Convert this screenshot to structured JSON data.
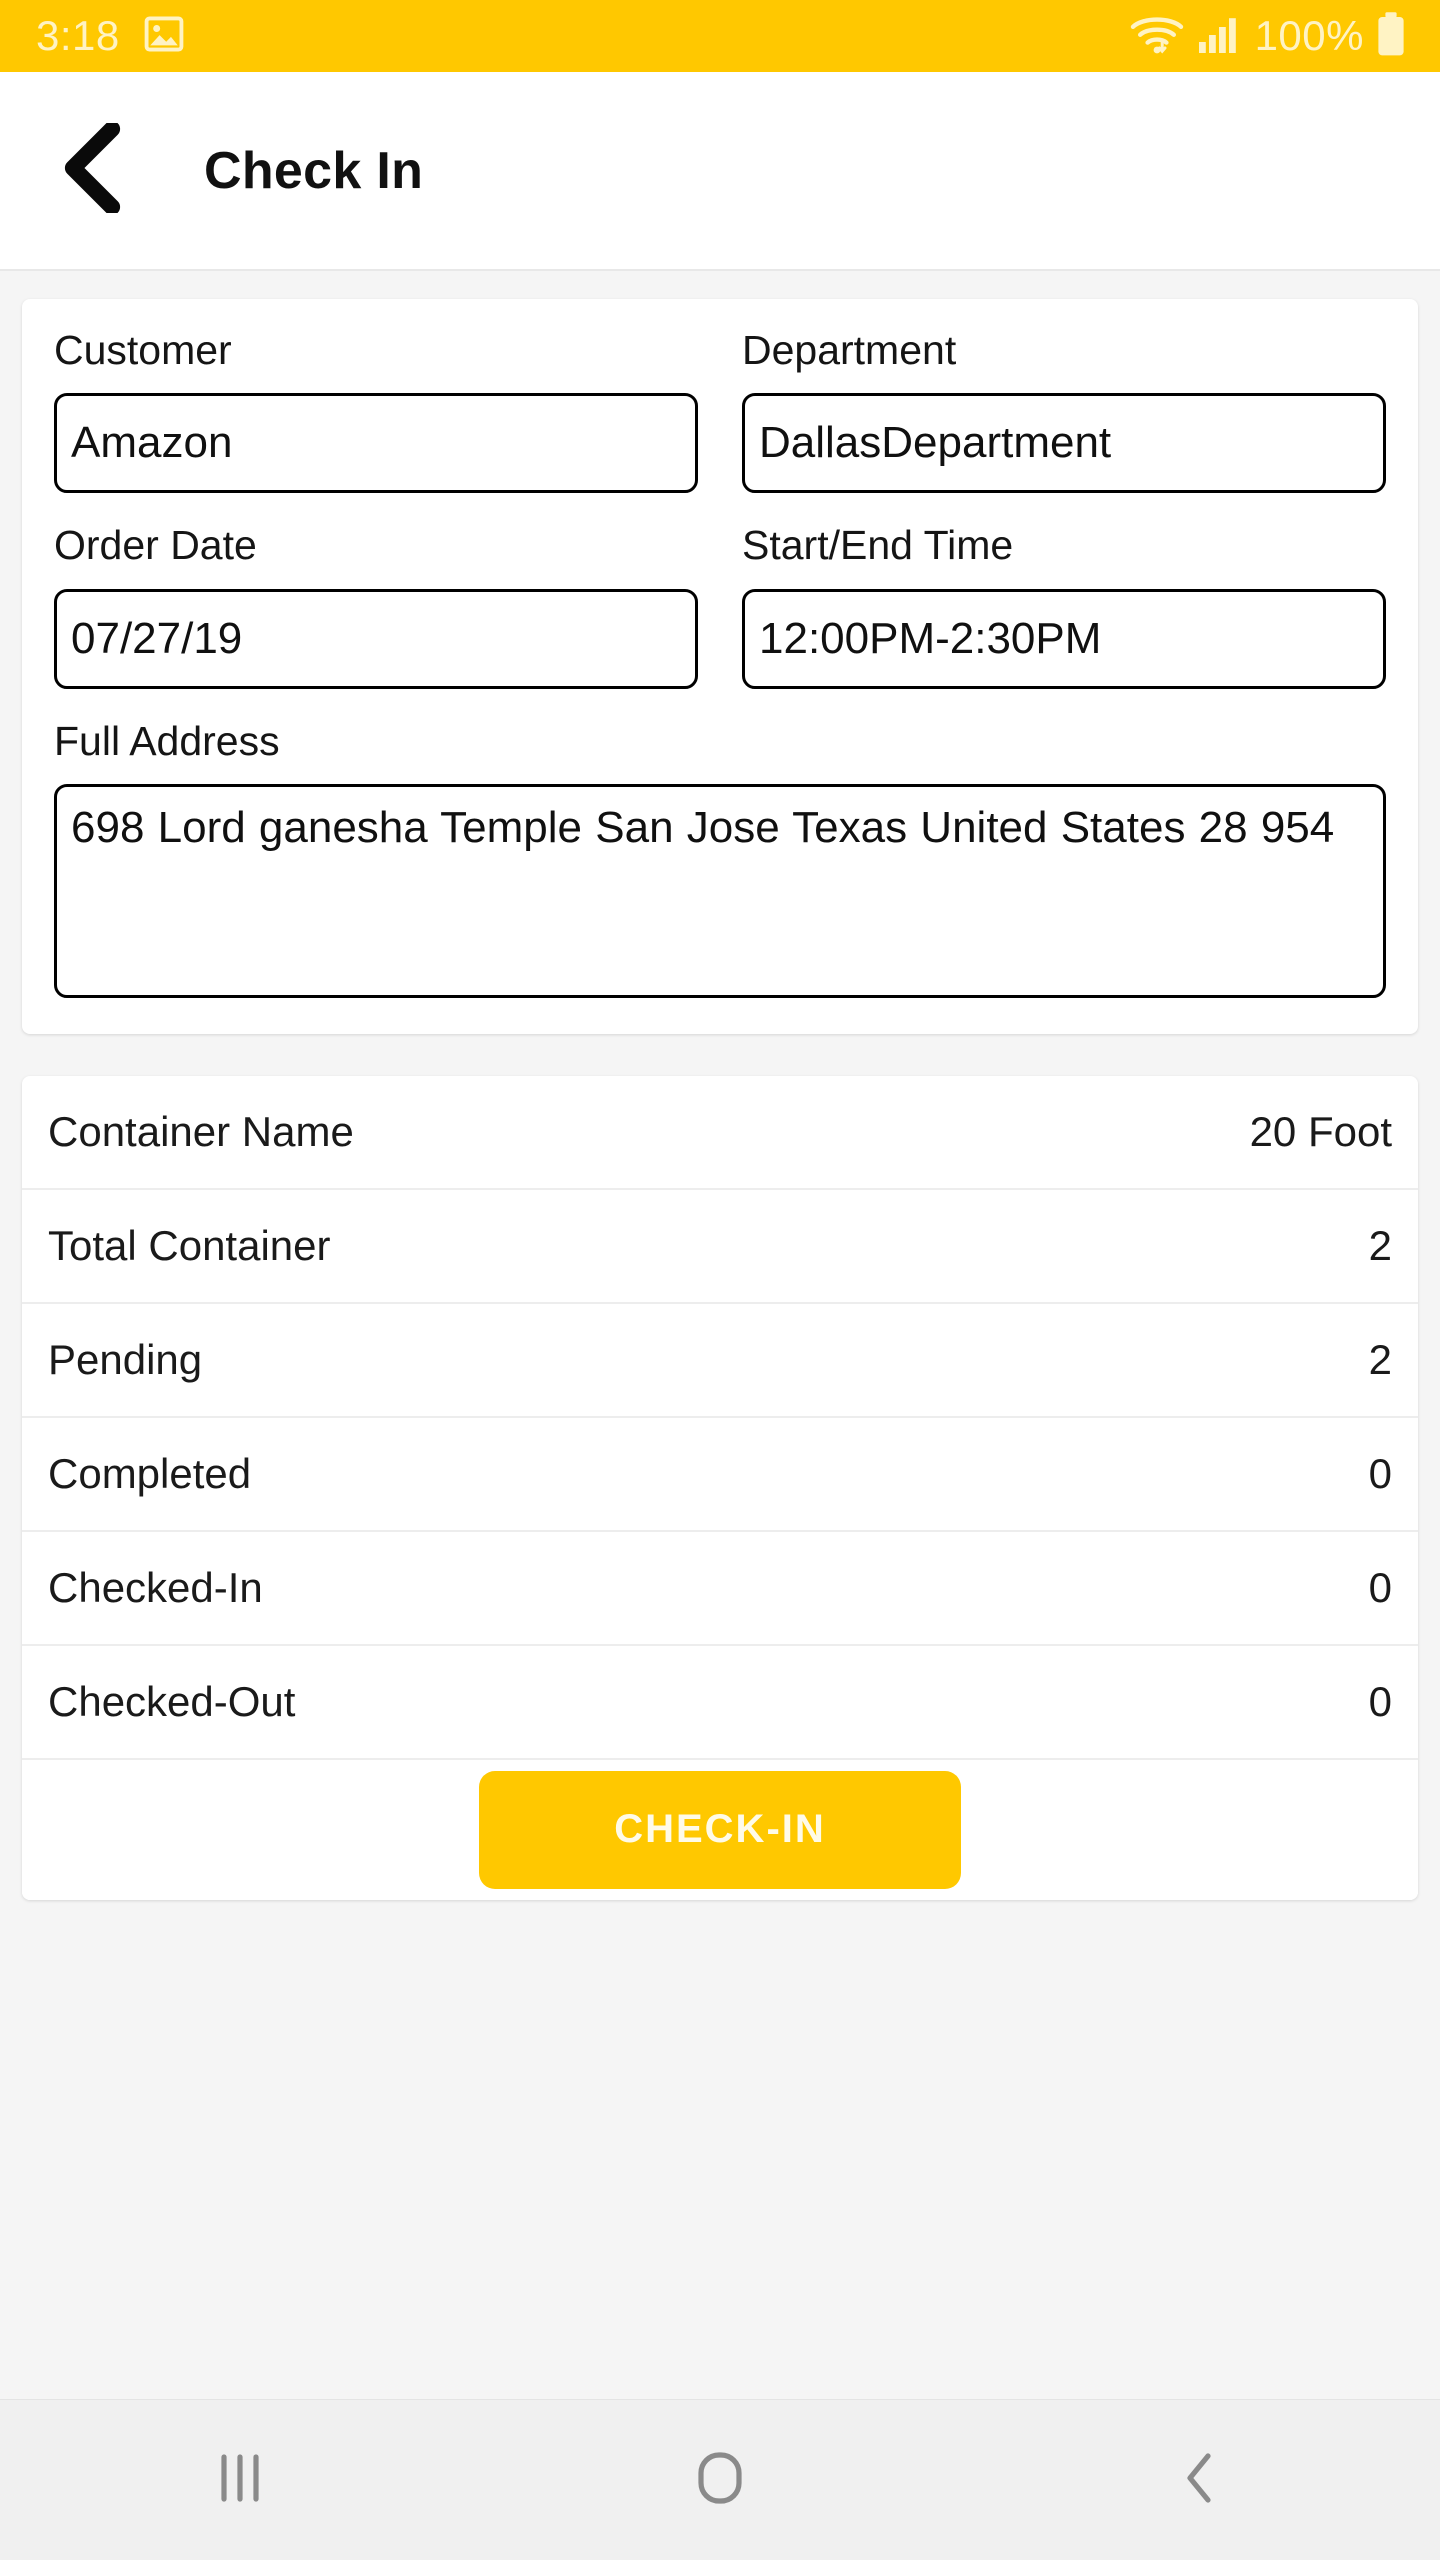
{
  "status_bar": {
    "time": "3:18",
    "battery_percent": "100%",
    "icons": [
      "image-notification-icon",
      "wifi-icon",
      "cellular-signal-icon",
      "battery-icon"
    ]
  },
  "app_bar": {
    "title": "Check In",
    "back_icon": "chevron-left-icon"
  },
  "form": {
    "fields": [
      {
        "label": "Customer",
        "value": "Amazon"
      },
      {
        "label": "Department",
        "value": "DallasDepartment"
      },
      {
        "label": "Order Date",
        "value": "07/27/19"
      },
      {
        "label": "Start/End Time",
        "value": "12:00PM-2:30PM"
      }
    ],
    "address": {
      "label": "Full Address",
      "value": "698 Lord ganesha Temple  San Jose Texas United States 28 954"
    }
  },
  "summary": {
    "rows": [
      {
        "key": "Container Name",
        "value": "20 Foot"
      },
      {
        "key": "Total Container",
        "value": "2"
      },
      {
        "key": "Pending",
        "value": "2"
      },
      {
        "key": "Completed",
        "value": "0"
      },
      {
        "key": "Checked-In",
        "value": "0"
      },
      {
        "key": "Checked-Out",
        "value": "0"
      }
    ],
    "action_button": "CHECK-IN"
  },
  "nav_bar": {
    "recents_icon": "recent-apps-icon",
    "home_icon": "home-icon",
    "back_icon": "back-icon"
  },
  "colors": {
    "accent": "#FFC800",
    "page_background": "#F5F5F5",
    "card_background": "#FFFFFF",
    "text_primary": "#111111",
    "status_bar_text": "#FFF3C4"
  }
}
